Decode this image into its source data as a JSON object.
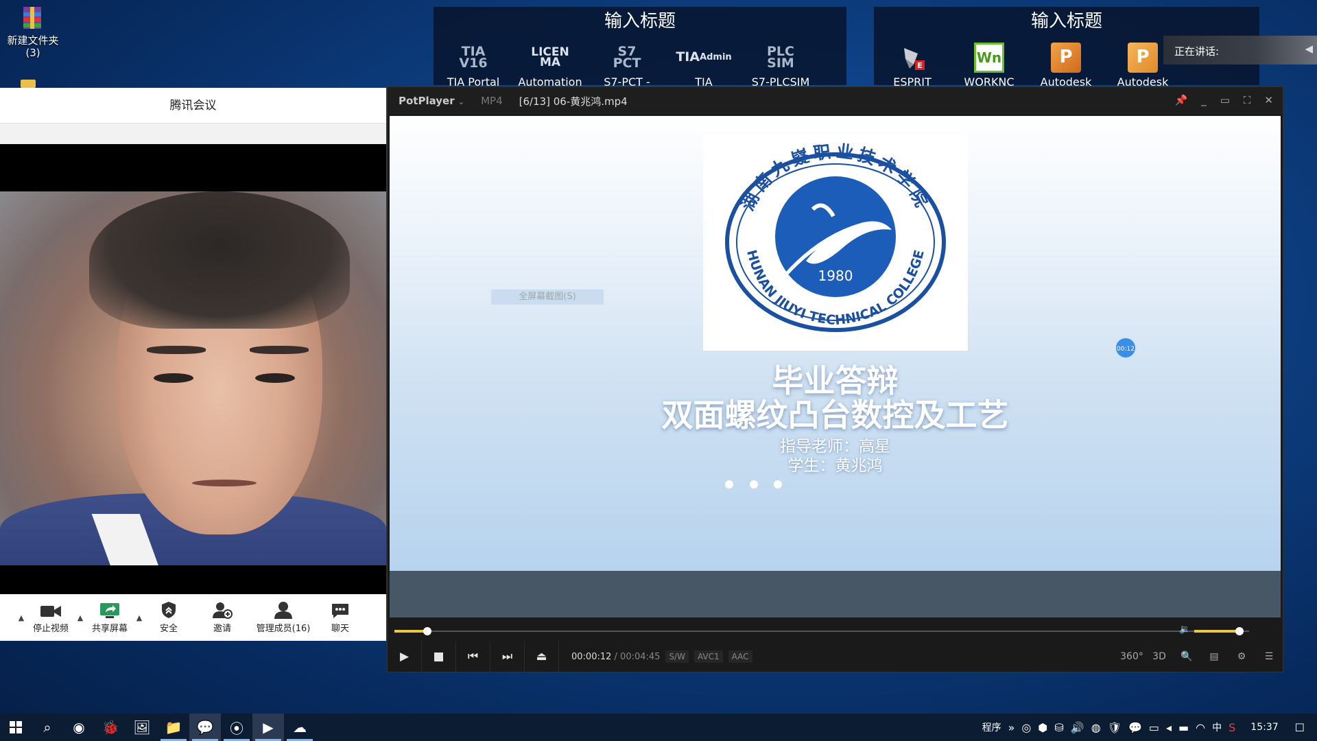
{
  "desktop": {
    "icons": [
      {
        "label": "新建文件夹\n(3)",
        "icon": "winrar-archive-icon"
      }
    ]
  },
  "launcher_left": {
    "title": "输入标题",
    "items": [
      {
        "label": "TIA Portal",
        "icon_text": "TIA\nV16",
        "color": "#aab8cc"
      },
      {
        "label": "Automation",
        "icon_text": "LICEN\nMA",
        "color": "#dde3ea"
      },
      {
        "label": "S7-PCT -",
        "icon_text": "S7\nPCT",
        "color": "#aab8cc"
      },
      {
        "label": "TIA",
        "icon_text": "TIA\nAdmin",
        "color": "#dde3ea"
      },
      {
        "label": "S7-PLCSIM",
        "icon_text": "PLC\nSIM",
        "color": "#aab8cc"
      }
    ]
  },
  "launcher_right": {
    "title": "输入标题",
    "items": [
      {
        "label": "ESPRIT",
        "icon": "esprit-icon"
      },
      {
        "label": "WORKNC",
        "icon_text": "Wn",
        "color": "#6cbf2f"
      },
      {
        "label": "Autodesk",
        "icon_text": "P",
        "color": "#e8862a"
      },
      {
        "label": "Autodesk",
        "icon_text": "P",
        "color": "#e89a3a"
      }
    ],
    "speaking_label": "正在讲话:"
  },
  "meeting": {
    "title": "腾讯会议",
    "toolbar": [
      {
        "label": "停止视频",
        "icon": "video-camera-icon",
        "caret": true
      },
      {
        "label": "共享屏幕",
        "icon": "share-screen-icon",
        "caret": true
      },
      {
        "label": "安全",
        "icon": "shield-icon",
        "caret": false
      },
      {
        "label": "邀请",
        "icon": "add-user-icon",
        "caret": false
      },
      {
        "label": "管理成员(16)",
        "icon": "members-icon",
        "caret": false
      },
      {
        "label": "聊天",
        "icon": "chat-icon",
        "caret": false
      }
    ]
  },
  "player": {
    "brand": "PotPlayer",
    "format": "MP4",
    "filename": "[6/13] 06-黄兆鸿.mp4",
    "slide": {
      "title": "毕业答辩",
      "subtitle": "双面螺纹凸台数控及工艺",
      "teacher": "指导老师：高星",
      "student": "学生：黄兆鸿",
      "logo_year": "1980",
      "logo_en": "HUNAN JIUYI TECHNICAL COLLEGE",
      "logo_cn": "湖南九嶷职业技术学院"
    },
    "ghost_menu": "全屏幕截图(S)",
    "time_bubble": "00:12",
    "current_time": "00:00:12",
    "total_time": "00:04:45",
    "progress": 0.042,
    "volume": 0.82,
    "tags": [
      "S/W",
      "AVC1",
      "AAC"
    ],
    "right_controls": [
      "360°",
      "3D"
    ]
  },
  "taskbar": {
    "tray_label": "程序",
    "ime": "中",
    "clock": "15:37"
  }
}
